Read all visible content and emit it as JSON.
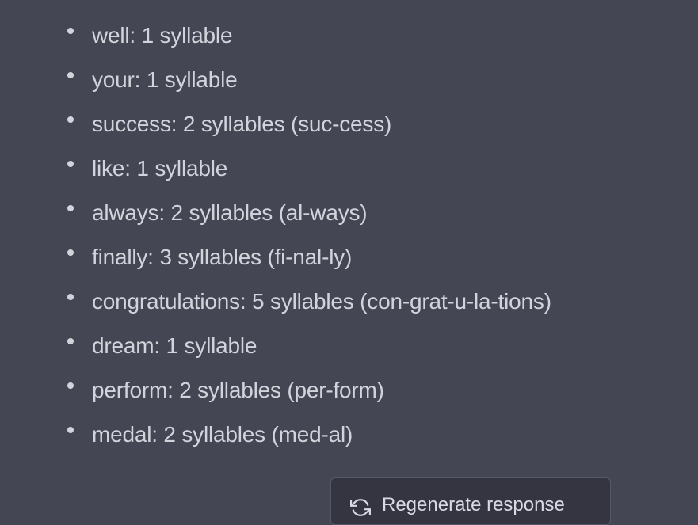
{
  "syllables": [
    "well: 1 syllable",
    "your: 1 syllable",
    "success: 2 syllables (suc-cess)",
    "like: 1 syllable",
    "always: 2 syllables (al-ways)",
    "finally: 3 syllables (fi-nal-ly)",
    "congratulations: 5 syllables (con-grat-u-la-tions)",
    "dream: 1 syllable",
    "perform: 2 syllables (per-form)",
    "medal: 2 syllables (med-al)"
  ],
  "regenerate": {
    "label": "Regenerate response",
    "icon": "refresh-icon"
  },
  "colors": {
    "background": "#444654",
    "text": "#d1d5db",
    "button_bg": "#343541",
    "button_border": "#565869"
  }
}
